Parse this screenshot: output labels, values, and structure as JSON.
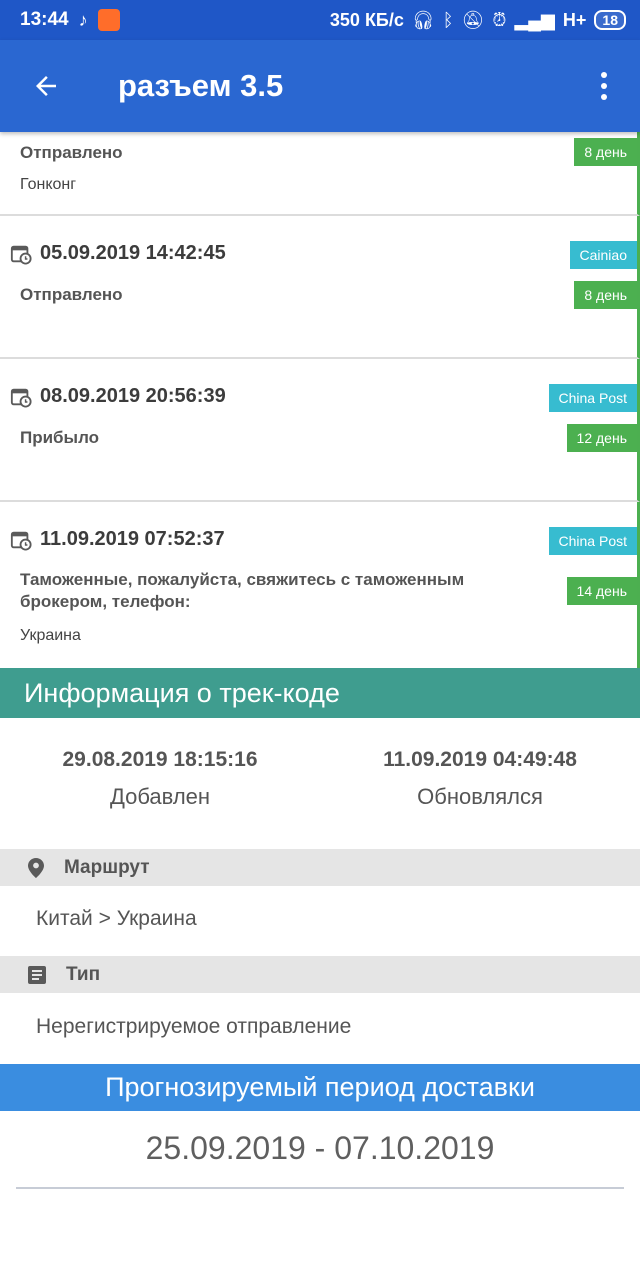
{
  "status_bar": {
    "time": "13:44",
    "speed": "350 КБ/с",
    "network": "H+",
    "battery": "18"
  },
  "app_bar": {
    "title": "разъем 3.5"
  },
  "events": [
    {
      "datetime": "",
      "status": "Отправлено",
      "location": "Гонконг",
      "carrier": "",
      "days": "8 день"
    },
    {
      "datetime": "05.09.2019 14:42:45",
      "status": "Отправлено",
      "location": "",
      "carrier": "Cainiao",
      "days": "8 день"
    },
    {
      "datetime": "08.09.2019 20:56:39",
      "status": "Прибыло",
      "location": "",
      "carrier": "China Post",
      "days": "12 день"
    },
    {
      "datetime": "11.09.2019 07:52:37",
      "status": "Таможенные, пожалуйста, свяжитесь с таможенным брокером, телефон:",
      "location": "Украина",
      "carrier": "China Post",
      "days": "14 день"
    }
  ],
  "info": {
    "header": "Информация о трек-коде",
    "added_value": "29.08.2019 18:15:16",
    "added_label": "Добавлен",
    "updated_value": "11.09.2019 04:49:48",
    "updated_label": "Обновлялся",
    "route_label": "Маршрут",
    "route_value": "Китай > Украина",
    "type_label": "Тип",
    "type_value": "Нерегистрируемое отправление"
  },
  "forecast": {
    "header": "Прогнозируемый период доставки",
    "value": "25.09.2019 - 07.10.2019"
  },
  "colors": {
    "status_bar": "#1f57c7",
    "app_bar": "#2a67d1",
    "days_badge": "#4cb050",
    "carrier_badge": "#37bcd0",
    "info_header": "#3f9d8f",
    "forecast_header": "#3a8de0"
  },
  "icons": [
    "back-arrow-icon",
    "more-vert-icon",
    "calendar-clock-icon",
    "location-pin-icon",
    "document-icon"
  ]
}
